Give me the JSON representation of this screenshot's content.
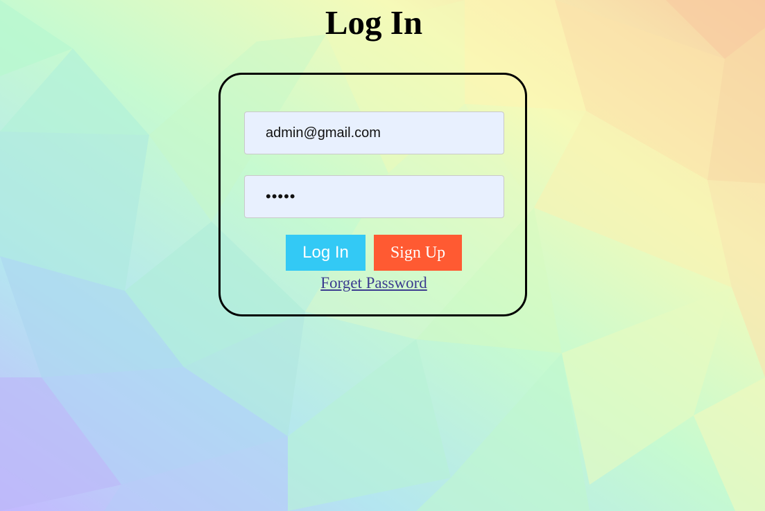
{
  "page": {
    "title": "Log In"
  },
  "form": {
    "email_value": "admin@gmail.com",
    "password_value": "•••••",
    "login_label": "Log In",
    "signup_label": "Sign Up",
    "forget_label": "Forget Password"
  },
  "colors": {
    "login_button": "#33c9f5",
    "signup_button": "#ff5a32",
    "input_background": "#e8f0fe"
  }
}
